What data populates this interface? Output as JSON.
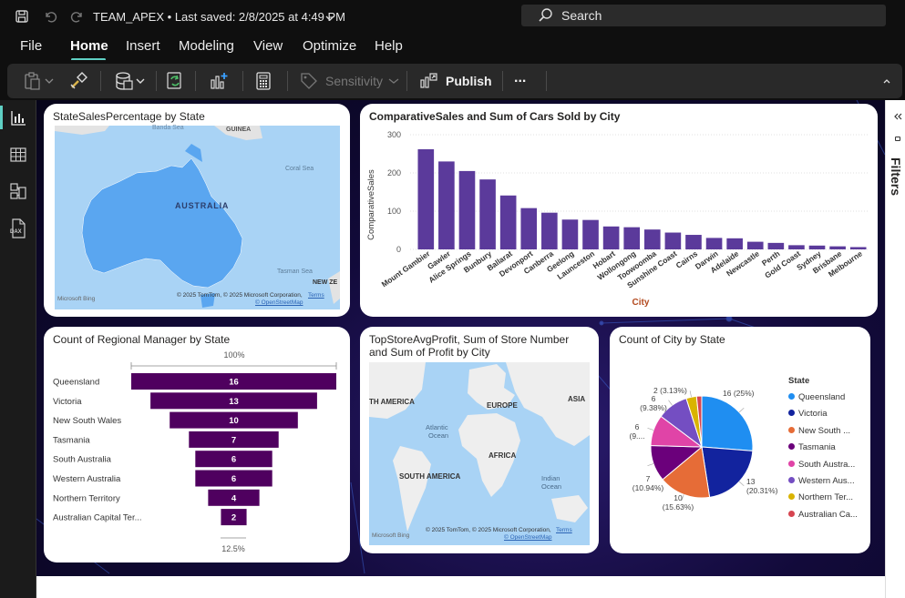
{
  "titlebar": {
    "file_name": "TEAM_APEX",
    "saved_status": "Last saved: 2/8/2025 at 4:49 PM",
    "search_placeholder": "Search"
  },
  "menu": [
    "File",
    "Home",
    "Insert",
    "Modeling",
    "View",
    "Optimize",
    "Help"
  ],
  "ribbon": {
    "sensitivity_label": "Sensitivity",
    "publish_label": "Publish",
    "more_label": "..."
  },
  "sidebar": {
    "icons": [
      "report-view-icon",
      "table-view-icon",
      "model-view-icon",
      "dax-query-icon"
    ],
    "dax_label": "DAX"
  },
  "right_pane": {
    "label": "Filters"
  },
  "colors": {
    "bar": "#5b3a9b",
    "funnel": "#4f005f",
    "map_water": "#a9d3f5",
    "map_land": "#5aa6f0"
  },
  "visual_state_map": {
    "title": "StateSalesPercentage by State",
    "labels": [
      "Banda Sea",
      "GUINEA",
      "AUSTRALIA",
      "Coral Sea",
      "Tasman Sea",
      "NEW ZE"
    ],
    "copyright": "© 2025 TomTom, © 2025 Microsoft Corporation,",
    "terms": "Terms",
    "osm": "© OpenStreetMap",
    "bing": "Microsoft Bing"
  },
  "visual_world_map": {
    "title_line1": "TopStoreAvgProfit, Sum of Store Number",
    "title_line2": "and Sum of Profit by City",
    "labels": [
      "TH AMERICA",
      "EUROPE",
      "ASIA",
      "Atlantic",
      "Ocean",
      "AFRICA",
      "SOUTH AMERICA",
      "Indian",
      "Ocean"
    ],
    "copyright": "© 2025 TomTom, © 2025 Microsoft Corporation,",
    "terms": "Terms",
    "osm": "© OpenStreetMap",
    "bing": "Microsoft Bing"
  },
  "chart_data": [
    {
      "type": "bar",
      "title": "ComparativeSales and Sum of Cars Sold by City",
      "xlabel": "City",
      "ylabel": "ComparativeSales",
      "ylim": [
        0,
        300
      ],
      "yticks": [
        "300",
        "200",
        "100",
        "0"
      ],
      "grid": true,
      "categories": [
        "Mount Gambier",
        "Gawler",
        "Alice Springs",
        "Bunbury",
        "Ballarat",
        "Devonport",
        "Canberra",
        "Geelong",
        "Launceston",
        "Hobart",
        "Wollongong",
        "Toowoomba",
        "Sunshine Coast",
        "Cairns",
        "Darwin",
        "Adelaide",
        "Newcastle",
        "Perth",
        "Gold Coast",
        "Sydney",
        "Brisbane",
        "Melbourne"
      ],
      "values": [
        262,
        230,
        205,
        183,
        141,
        108,
        96,
        78,
        77,
        60,
        58,
        52,
        44,
        38,
        30,
        29,
        20,
        17,
        11,
        10,
        8,
        6
      ]
    },
    {
      "type": "funnel",
      "title": "Count of Regional Manager by State",
      "top_label": "100%",
      "bottom_label": "12.5%",
      "categories": [
        "Queensland",
        "Victoria",
        "New South Wales",
        "Tasmania",
        "South Australia",
        "Western Australia",
        "Northern Territory",
        "Australian Capital Ter..."
      ],
      "values": [
        16,
        13,
        10,
        7,
        6,
        6,
        4,
        2
      ],
      "value_labels": [
        "16",
        "13",
        "10",
        "7",
        "6",
        "6",
        "4",
        "2"
      ]
    },
    {
      "type": "pie",
      "title": "Count of City by State",
      "legend_title": "State",
      "legend_position": "right",
      "categories": [
        "Queensland",
        "Victoria",
        "New South ...",
        "Tasmania",
        "South Austra...",
        "Western Aus...",
        "Northern Ter...",
        "Australian Ca..."
      ],
      "values": [
        16,
        13,
        10,
        7,
        6,
        6,
        2,
        1
      ],
      "colors": [
        "#1f8ef1",
        "#12239e",
        "#e66c37",
        "#6b007b",
        "#e044a7",
        "#744ec2",
        "#d9b300",
        "#d64550"
      ],
      "data_labels": [
        {
          "count": "16",
          "pct": "(25%)"
        },
        {
          "count": "13",
          "pct": "(20.31%)"
        },
        {
          "count": "10",
          "pct": "(15.63%)"
        },
        {
          "count": "7",
          "pct": "(10.94%)"
        },
        {
          "count": "6",
          "pct": "(9...."
        },
        {
          "count": "6",
          "pct": "(9.38%)"
        },
        {
          "count": "2",
          "pct": "(3.13%)"
        }
      ]
    }
  ]
}
